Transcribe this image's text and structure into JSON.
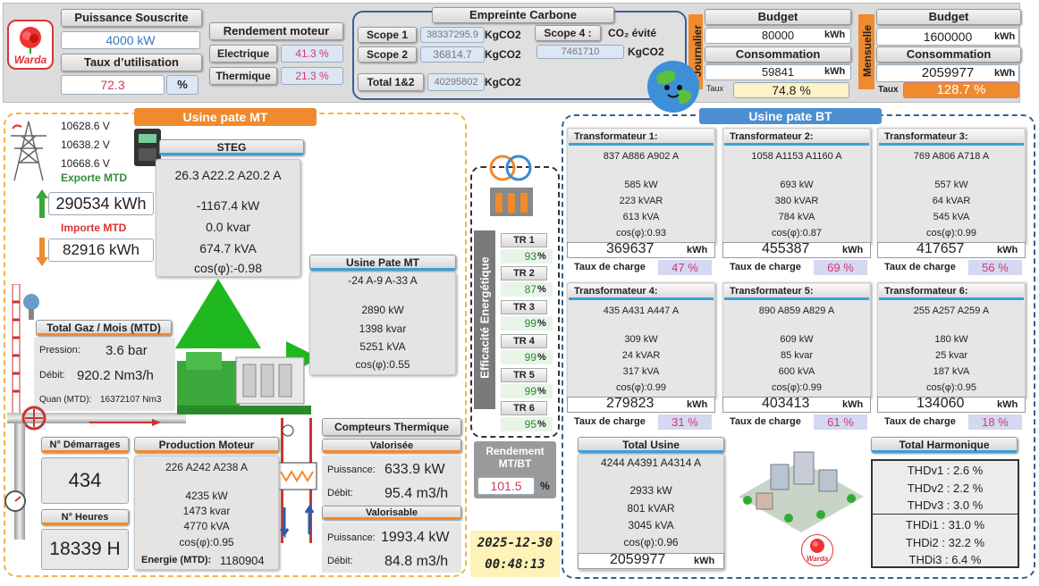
{
  "header": {
    "puissance_souscrite_label": "Puissance Souscrite",
    "puissance_souscrite_value": "4000 kW",
    "taux_utilisation_label": "Taux d’utilisation",
    "taux_utilisation_value": "72.3",
    "taux_utilisation_unit": "%",
    "rendement_label": "Rendement moteur",
    "electrique_label": "Electrique",
    "electrique_value": "41.3 %",
    "thermique_label": "Thermique",
    "thermique_value": "21.3 %",
    "empreinte_label": "Empreinte Carbone",
    "scope1_label": "Scope 1",
    "scope1_value": "38337295.9",
    "scope1_unit": "KgCO2",
    "scope2_label": "Scope 2",
    "scope2_value": "36814.7",
    "scope2_unit": "KgCO2",
    "scope4_label": "Scope 4 :",
    "co2_evite_label": "CO₂ évité",
    "scope4_value": "7461710",
    "scope4_unit": "KgCO2",
    "total_label": "Total 1&2",
    "total_value": "40295802",
    "total_unit": "KgCO2",
    "journalier_label": "Journalier",
    "budget_j_label": "Budget",
    "budget_j_value": "80000",
    "budget_j_unit": "kWh",
    "conso_j_label": "Consommation",
    "conso_j_value": "59841",
    "conso_j_unit": "kWh",
    "taux_j_label": "Taux",
    "taux_j_value": "74.8 %",
    "mensuelle_label": "Mensuelle",
    "budget_m_label": "Budget",
    "budget_m_value": "1600000",
    "budget_m_unit": "kWh",
    "conso_m_label": "Consommation",
    "conso_m_value": "2059977",
    "conso_m_unit": "kWh",
    "taux_m_label": "Taux",
    "taux_m_value": "128.7 %"
  },
  "mt": {
    "title": "Usine pate MT",
    "v1": "10628.6 V",
    "v2": "10638.2 V",
    "v3": "10668.6 V",
    "exporte_label": "Exporte MTD",
    "exporte_value": "290534 kWh",
    "importe_label": "Importe MTD",
    "importe_value": "82916 kWh",
    "steg_label": "STEG",
    "steg_currents": "26.3 A22.2 A20.2 A",
    "steg_kw": "-1167.4 kW",
    "steg_kvar": "0.0 kvar",
    "steg_kva": "674.7 kVA",
    "steg_cos": "cos(φ):-0.98",
    "usine_label": "Usine Pate MT",
    "usine_currents": "-24 A-9 A-33 A",
    "usine_kw": "2890 kW",
    "usine_kvar": "1398 kvar",
    "usine_kva": "5251 kVA",
    "usine_cos": "cos(φ):0.55",
    "gaz_label": "Total Gaz / Mois (MTD)",
    "pression_label": "Pression:",
    "pression_value": "3.6 bar",
    "debit_label": "Débit:",
    "debit_value": "920.2 Nm3/h",
    "quan_label": "Quan (MTD):",
    "quan_value": "16372107 Nm3",
    "demarrages_label": "N° Démarrages",
    "demarrages_value": "434",
    "heures_label": "N° Heures",
    "heures_value": "18339 H",
    "prod_label": "Production Moteur",
    "prod_currents": "226 A242 A238 A",
    "prod_kw": "4235 kW",
    "prod_kvar": "1473 kvar",
    "prod_kva": "4770 kVA",
    "prod_cos": "cos(φ):0.95",
    "energie_label": "Energie (MTD):",
    "energie_value": "1180904",
    "compteurs_label": "Compteurs Thermique",
    "valorisee_label": "Valorisée",
    "val_puissance_label": "Puissance:",
    "val_puissance_value": "633.9 kW",
    "val_debit_label": "Débit:",
    "val_debit_value": "95.4 m3/h",
    "valorisable_label": "Valorisable",
    "vab_puissance_label": "Puissance:",
    "vab_puissance_value": "1993.4 kW",
    "vab_debit_label": "Débit:",
    "vab_debit_value": "84.8 m3/h"
  },
  "efficacite": {
    "title": "Efficacité Energétique",
    "rows": [
      {
        "label": "TR 1",
        "value": "93"
      },
      {
        "label": "TR 2",
        "value": "87"
      },
      {
        "label": "TR 3",
        "value": "99"
      },
      {
        "label": "TR 4",
        "value": "99"
      },
      {
        "label": "TR 5",
        "value": "99"
      },
      {
        "label": "TR 6",
        "value": "95"
      }
    ],
    "pct": "%",
    "rendement_label": "Rendement MT/BT",
    "rendement_value": "101.5",
    "rendement_unit": "%",
    "date": "2025-12-30",
    "time": "00:48:13"
  },
  "bt": {
    "title": "Usine pate BT",
    "charge_label": "Taux de charge",
    "kwh": "kWh",
    "transformers": [
      {
        "title": "Transformateur 1:",
        "currents": "837 A886 A902 A",
        "kw": "585 kW",
        "kvar": "223 kVAR",
        "kva": "613 kVA",
        "cos": "cos(φ):0.93",
        "energy": "369637",
        "charge": "47 %"
      },
      {
        "title": "Transformateur 2:",
        "currents": "1058 A1153 A1160 A",
        "kw": "693 kW",
        "kvar": "380 kVAR",
        "kva": "784 kVA",
        "cos": "cos(φ):0.87",
        "energy": "455387",
        "charge": "69 %"
      },
      {
        "title": "Transformateur 3:",
        "currents": "769 A806 A718 A",
        "kw": "557 kW",
        "kvar": "64 kVAR",
        "kva": "545 kVA",
        "cos": "cos(φ):0.99",
        "energy": "417657",
        "charge": "56 %"
      },
      {
        "title": "Transformateur 4:",
        "currents": "435 A431 A447 A",
        "kw": "309 kW",
        "kvar": "24 kVAR",
        "kva": "317 kVA",
        "cos": "cos(φ):0.99",
        "energy": "279823",
        "charge": "31 %"
      },
      {
        "title": "Transformateur 5:",
        "currents": "890 A859 A829 A",
        "kw": "609 kW",
        "kvar": "85 kvar",
        "kva": "600 kVA",
        "cos": "cos(φ):0.99",
        "energy": "403413",
        "charge": "61 %"
      },
      {
        "title": "Transformateur 6:",
        "currents": "255 A257 A259 A",
        "kw": "180 kW",
        "kvar": "25 kvar",
        "kva": "187 kVA",
        "cos": "cos(φ):0.95",
        "energy": "134060",
        "charge": "18 %"
      }
    ],
    "total_label": "Total Usine",
    "total_currents": "4244 A4391 A4314 A",
    "total_kw": "2933 kW",
    "total_kvar": "801 kVAR",
    "total_kva": "3045 kVA",
    "total_cos": "cos(φ):0.96",
    "total_energy": "2059977",
    "harm_label": "Total Harmonique",
    "thdv1": "THDv1 : 2.6 %",
    "thdv2": "THDv2 : 2.2 %",
    "thdv3": "THDv3 : 3.0 %",
    "thdi1": "THDi1 : 31.0 %",
    "thdi2": "THDi2 : 32.2 %",
    "thdi3": "THDi3 : 6.4 %"
  },
  "brand": "Warda",
  "colors": {
    "orange": "#ef8a2e",
    "blue": "#4b8fd0",
    "green": "#1fb81f",
    "red_text": "#d03a6a"
  }
}
